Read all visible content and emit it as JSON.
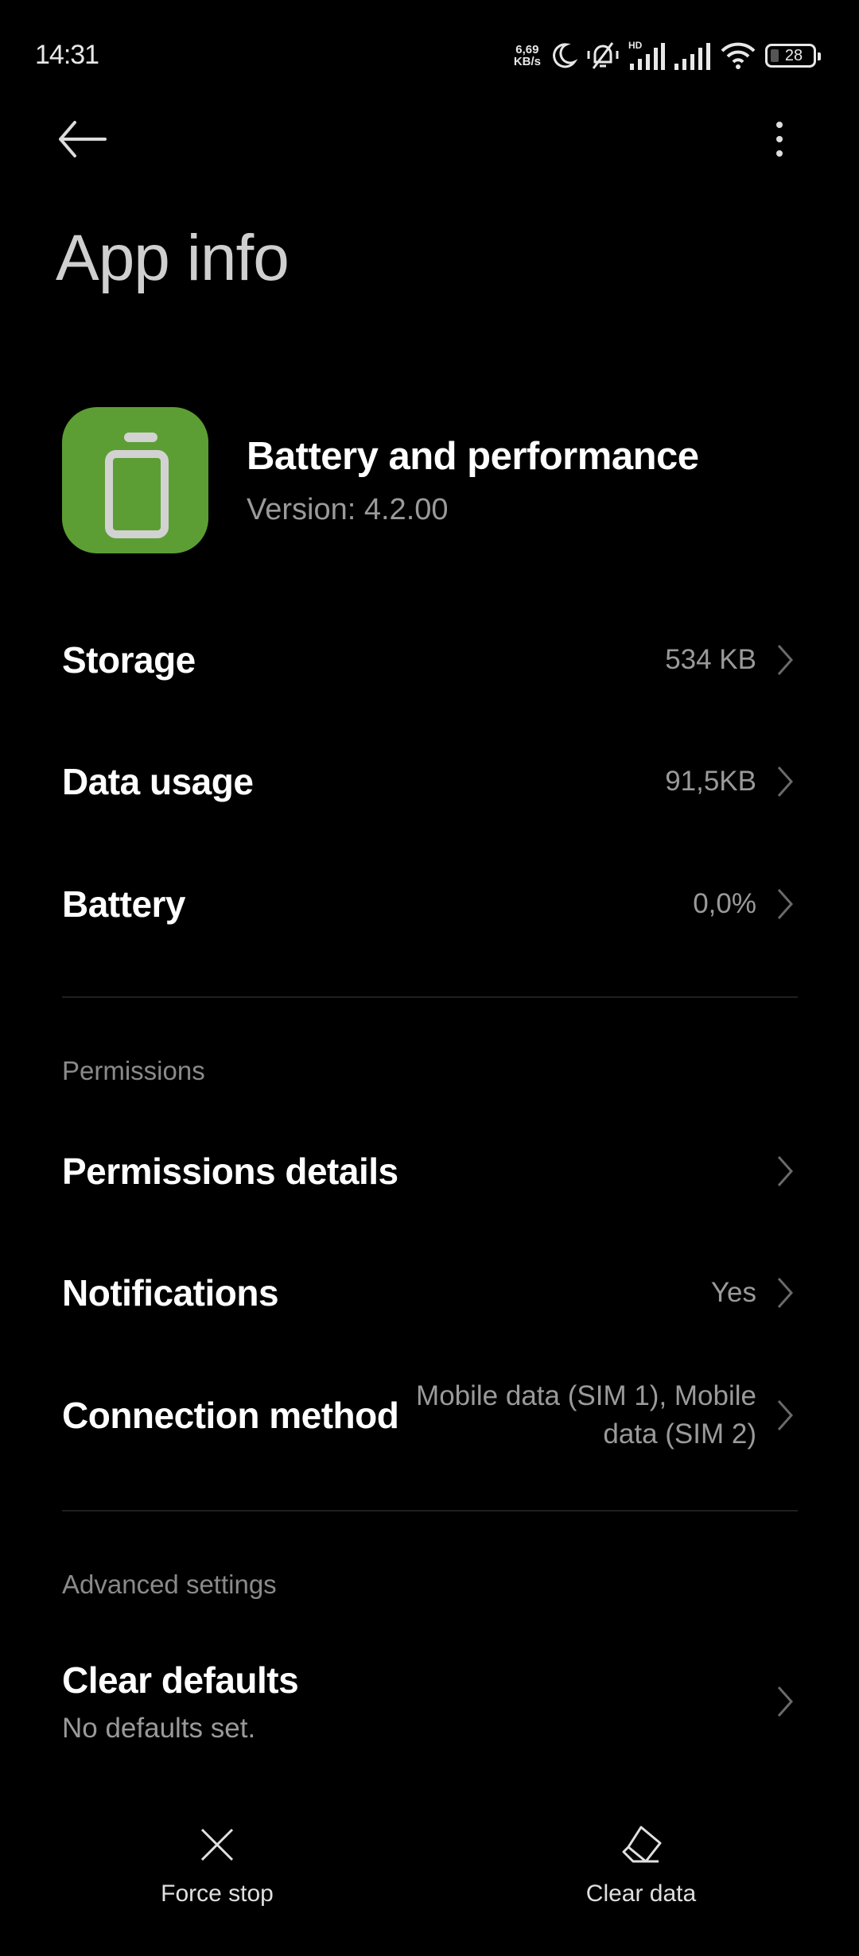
{
  "status_bar": {
    "time": "14:31",
    "net_speed_value": "6,69",
    "net_speed_unit": "KB/s",
    "icons": [
      "moon-icon",
      "bell-off-icon",
      "signal-hd-icon",
      "signal-icon",
      "wifi-icon",
      "battery-icon"
    ],
    "signal_hd_label": "HD",
    "battery_level": "28"
  },
  "header": {
    "back_icon": "arrow-left-icon",
    "more_icon": "more-vertical-icon",
    "title": "App info"
  },
  "app": {
    "name": "Battery and performance",
    "version": "Version: 4.2.00",
    "icon": "battery-app-icon",
    "icon_color": "#5c9e34"
  },
  "usage_rows": [
    {
      "label": "Storage",
      "value": "534 KB"
    },
    {
      "label": "Data usage",
      "value": "91,5KB"
    },
    {
      "label": "Battery",
      "value": "0,0%"
    }
  ],
  "permissions": {
    "section_title": "Permissions",
    "rows": [
      {
        "label": "Permissions details",
        "value": ""
      },
      {
        "label": "Notifications",
        "value": "Yes"
      },
      {
        "label": "Connection method",
        "value": "Mobile data (SIM 1), Mobile data (SIM 2)"
      }
    ]
  },
  "advanced": {
    "section_title": "Advanced settings",
    "rows": [
      {
        "label": "Clear defaults",
        "subtitle": "No defaults set."
      }
    ]
  },
  "bottom_actions": [
    {
      "label": "Force stop",
      "icon": "close-icon"
    },
    {
      "label": "Clear data",
      "icon": "eraser-icon"
    }
  ]
}
